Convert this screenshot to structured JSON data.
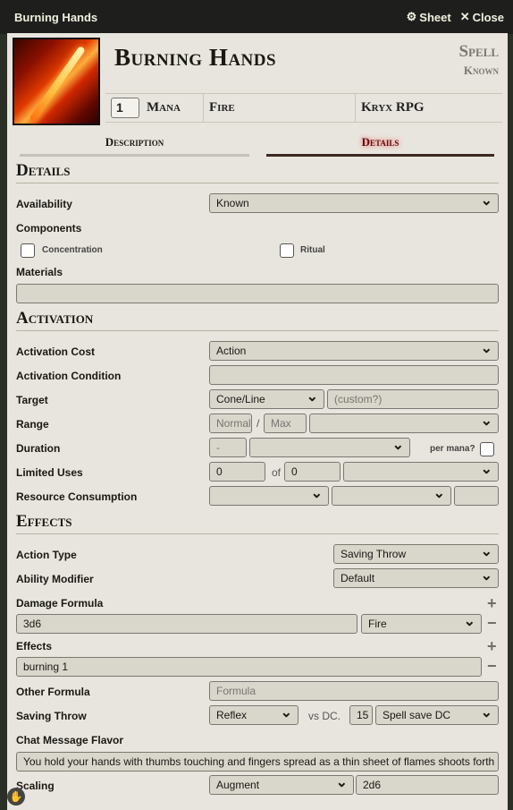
{
  "window": {
    "title": "Burning Hands",
    "sheet_label": "Sheet",
    "close_label": "Close"
  },
  "header": {
    "name": "Burning Hands",
    "type_label": "Spell",
    "status_label": "Known",
    "level_value": "1",
    "cost_label": "Mana",
    "damage_type": "Fire",
    "source": "Kryx RPG"
  },
  "tabs": {
    "description": "Description",
    "details": "Details",
    "active": "details"
  },
  "details": {
    "heading": "Details",
    "availability_label": "Availability",
    "availability_value": "Known",
    "components_label": "Components",
    "concentration_label": "Concentration",
    "ritual_label": "Ritual",
    "materials_label": "Materials",
    "materials_value": ""
  },
  "activation": {
    "heading": "Activation",
    "cost_label": "Activation Cost",
    "cost_value": "Action",
    "condition_label": "Activation Condition",
    "condition_value": "",
    "target_label": "Target",
    "target_value": "Cone/Line",
    "target_custom_placeholder": "(custom?)",
    "range_label": "Range",
    "range_normal_placeholder": "Normal",
    "range_separator": "/",
    "range_max_placeholder": "Max",
    "range_units": "",
    "duration_label": "Duration",
    "duration_value_placeholder": "-",
    "duration_units": "",
    "per_mana_label": "per mana?",
    "limited_uses_label": "Limited Uses",
    "uses_value": "0",
    "uses_of": "of",
    "uses_max": "0",
    "uses_period": "",
    "resource_label": "Resource Consumption"
  },
  "effects": {
    "heading": "Effects",
    "action_type_label": "Action Type",
    "action_type_value": "Saving Throw",
    "ability_label": "Ability Modifier",
    "ability_value": "Default",
    "damage_label": "Damage Formula",
    "damage_formula": "3d6",
    "damage_type": "Fire",
    "effects_label": "Effects",
    "effect_value": "burning 1",
    "other_label": "Other Formula",
    "other_placeholder": "Formula",
    "save_label": "Saving Throw",
    "save_ability": "Reflex",
    "save_vs": "vs DC.",
    "save_dc": "15",
    "save_scaling": "Spell save DC",
    "flavor_label": "Chat Message Flavor",
    "flavor_value": "You hold your hands with thumbs touching and fingers spread as a thin sheet of flames shoots forth",
    "scaling_label": "Scaling",
    "scaling_mode": "Augment",
    "scaling_formula": "2d6"
  }
}
